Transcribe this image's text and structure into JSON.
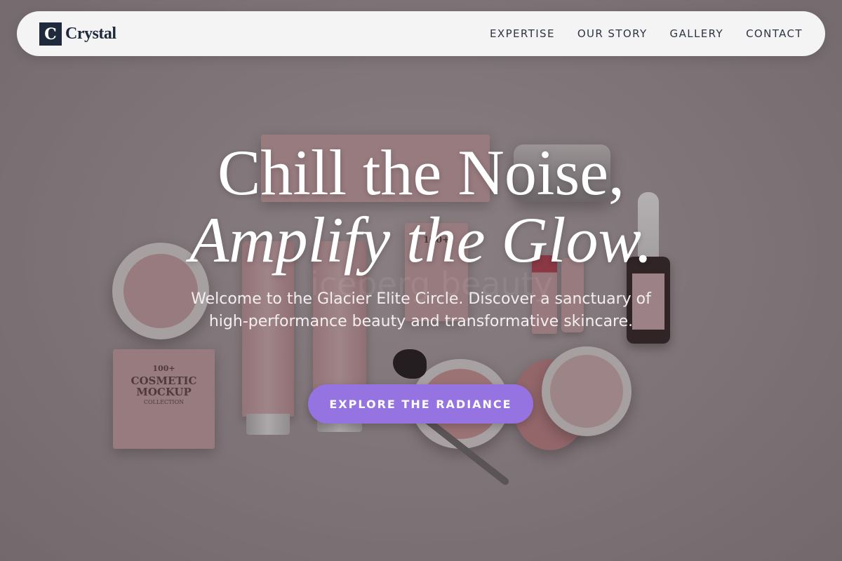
{
  "brand": {
    "logo_letter": "C",
    "name": "Crystal"
  },
  "nav": {
    "items": [
      "EXPERTISE",
      "OUR STORY",
      "GALLERY",
      "CONTACT"
    ]
  },
  "hero": {
    "headline_line1": "Chill the Noise,",
    "headline_line2": "Amplify the Glow.",
    "subtitle": "Welcome to the Glacier Elite Circle. Discover a sanctuary of high-performance beauty and transformative skincare.",
    "cta_label": "EXPLORE THE RADIANCE"
  },
  "background": {
    "watermark": "iceberg beauty",
    "product_labels": {
      "box_small": "100+",
      "box_main": "COSMETIC MOCKUP",
      "box_edition": "COLLECTION"
    }
  },
  "colors": {
    "nav_bg": "#f4f4f5",
    "brand_dark": "#1f2a3d",
    "cta": "#9573e0",
    "product_pink": "#cfa8aa"
  }
}
